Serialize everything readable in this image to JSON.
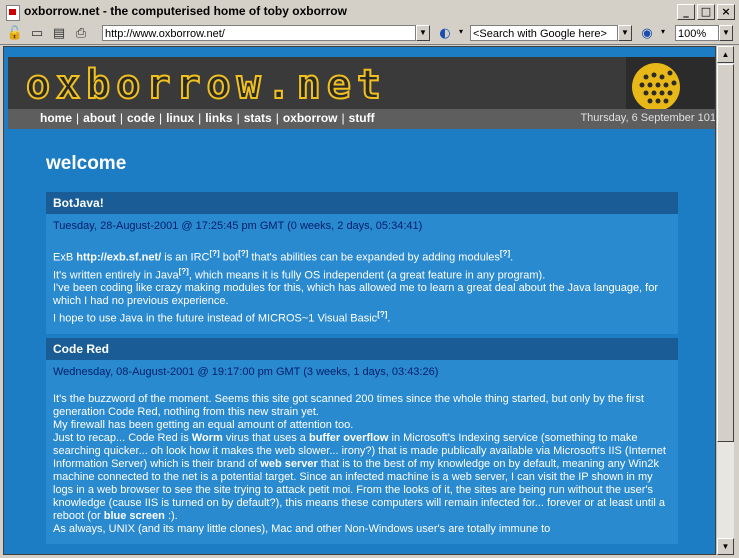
{
  "window": {
    "title": "oxborrow.net - the computerised home of toby oxborrow",
    "minimize": "_",
    "maximize": "□",
    "close": "×"
  },
  "toolbar": {
    "url": "http://www.oxborrow.net/",
    "search_placeholder": "<Search with Google here>",
    "zoom": "100%"
  },
  "site": {
    "logo_text": "oxborrow.net",
    "nav": [
      "home",
      "about",
      "code",
      "linux",
      "links",
      "stats",
      "oxborrow",
      "stuff"
    ],
    "date": "Thursday, 6 September 101"
  },
  "page": {
    "heading": "welcome"
  },
  "articles": [
    {
      "title": "BotJava!",
      "date": "Tuesday, 28-August-2001 @ 17:25:45 pm GMT (0 weeks, 2 days, 05:34:41)",
      "p1_a": "ExB ",
      "p1_link": "http://exb.sf.net/",
      "p1_b": " is an IRC",
      "p1_c": " bot",
      "p1_d": " that's abilities can be expanded by adding modules",
      "p1_e": ".",
      "p2_a": "It's written entirely in Java",
      "p2_b": ", which means it is fully OS independent (a great feature in any program).",
      "p3": "I've been coding like crazy making modules for this, which has allowed me to learn a great deal about the Java language, for which I had no previous experience.",
      "p4_a": "I hope to use Java in the future instead of MICROS~1 Visual Basic",
      "p4_b": ".",
      "sup": "[?]"
    },
    {
      "title": "Code Red",
      "date": "Wednesday, 08-August-2001 @ 19:17:00 pm GMT (3 weeks, 1 days, 03:43:26)",
      "p1": "It's the buzzword of the moment. Seems this site got scanned 200 times since the whole thing started, but only by the first generation Code Red, nothing from this new strain yet.",
      "p2": "My firewall has been getting an equal amount of attention too.",
      "p3_a": "Just to recap... Code Red is ",
      "p3_b": "Worm",
      "p3_c": " virus that uses a ",
      "p3_d": "buffer overflow",
      "p3_e": " in Microsoft's Indexing service (something to make searching quicker... oh look how it makes the web slower... irony?) that is made publically available via Microsoft's IIS (Internet Information Server) which is their brand of ",
      "p3_f": "web server",
      "p3_g": " that is to the best of my knowledge on by default, meaning any Win2k machine connected to the net is a potential target. Since an infected machine is a web server, I can visit the IP shown in my logs in a web browser to see the site trying to attack petit moi. From the looks of it, the sites are being run without the user's knowledge (cause IIS is turned on by default?), this means these computers will remain infected for... forever or at least until a reboot (or ",
      "p3_h": "blue screen",
      "p3_i": " :).",
      "p4": "As always, UNIX (and its many little clones), Mac and other Non-Windows user's are totally immune to"
    }
  ]
}
